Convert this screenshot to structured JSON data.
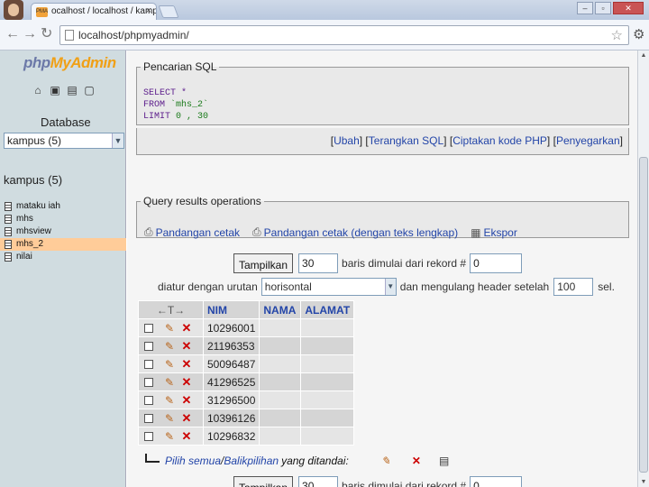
{
  "browser": {
    "tab_title": "ocalhost / localhost / kampus",
    "tab_favicon": "PMA",
    "url": "localhost/phpmyadmin/",
    "back_icon": "back-arrow-icon",
    "forward_icon": "forward-arrow-icon",
    "reload_icon": "reload-icon",
    "star_icon": "star-icon",
    "wrench_icon": "wrench-icon"
  },
  "sidebar": {
    "logo_php": "php",
    "logo_myadmin": "MyAdmin",
    "database_label": "Database",
    "database_select": "kampus (5)",
    "db_name": "kampus (5)",
    "tables": [
      {
        "label": "mataku iah"
      },
      {
        "label": "mhs"
      },
      {
        "label": "mhsview"
      },
      {
        "label": "mhs_2"
      },
      {
        "label": "nilai"
      }
    ],
    "active_table_index": 3
  },
  "sql_box": {
    "legend": "Pencarian SQL",
    "line1": "SELECT *",
    "line2_kw": "FROM ",
    "line2_val": "`mhs_2`",
    "line3_kw": "LIMIT ",
    "line3_val": "0 , 30",
    "links": {
      "ubah": "Ubah",
      "terangkan": "Terangkan SQL",
      "ciptakan": "Ciptakan kode PHP",
      "segarkan": "Penyegarkan"
    }
  },
  "operations": {
    "legend": "Query results operations",
    "items": [
      {
        "label": "Pandangan cetak",
        "icon": "print-icon"
      },
      {
        "label": "Pandangan cetak (dengan teks lengkap)",
        "icon": "print-icon"
      },
      {
        "label": "Ekspor",
        "icon": "export-icon"
      }
    ]
  },
  "pager": {
    "show_button": "Tampilkan",
    "rows_value": "30",
    "rows_label": "baris dimulai dari rekord #",
    "start_value": "0",
    "order_label": "diatur dengan urutan",
    "order_value": "horisontal",
    "repeat_label": "dan mengulang header setelah",
    "repeat_value": "100",
    "cells_label": "sel."
  },
  "results_table": {
    "arrow_header": "←T→",
    "columns": [
      "NIM",
      "NAMA",
      "ALAMAT"
    ],
    "rows": [
      {
        "nim": "10296001",
        "nama": "",
        "alamat": ""
      },
      {
        "nim": "21196353",
        "nama": "",
        "alamat": ""
      },
      {
        "nim": "50096487",
        "nama": "",
        "alamat": ""
      },
      {
        "nim": "41296525",
        "nama": "",
        "alamat": ""
      },
      {
        "nim": "31296500",
        "nama": "",
        "alamat": ""
      },
      {
        "nim": "10396126",
        "nama": "",
        "alamat": ""
      },
      {
        "nim": "10296832",
        "nama": "",
        "alamat": ""
      }
    ]
  },
  "bulk": {
    "check_all": "Pilih semua",
    "separator": " / ",
    "uncheck_all": "Balikpilihan",
    "with_selected": "yang ditandai:"
  },
  "colors": {
    "left_frame_bg": "#d0dce0",
    "link_blue": "#2345a8",
    "active_table_bg": "#ffcc99",
    "sql_keyword": "#5a1a8a",
    "delete_red": "#cc0000"
  }
}
